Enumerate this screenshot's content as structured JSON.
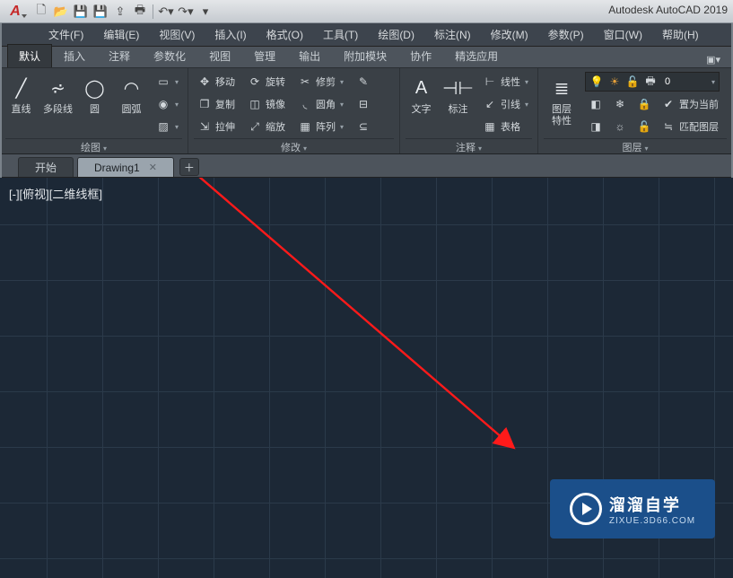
{
  "title": "Autodesk AutoCAD 2019",
  "menubar": {
    "file": "文件(F)",
    "edit": "编辑(E)",
    "view": "视图(V)",
    "insert": "插入(I)",
    "format": "格式(O)",
    "tools": "工具(T)",
    "draw": "绘图(D)",
    "dimension": "标注(N)",
    "modify": "修改(M)",
    "parametric": "参数(P)",
    "window": "窗口(W)",
    "help": "帮助(H)"
  },
  "ribbon_tabs": {
    "default": "默认",
    "insert": "插入",
    "annotate": "注释",
    "parametric": "参数化",
    "view": "视图",
    "manage": "管理",
    "output": "输出",
    "addins": "附加模块",
    "collab": "协作",
    "featured": "精选应用"
  },
  "ribbon": {
    "draw_panel": "绘图",
    "modify_panel": "修改",
    "annotation_panel": "注释",
    "layers_panel": "图层",
    "line": "直线",
    "polyline": "多段线",
    "circle": "圆",
    "arc": "圆弧",
    "move": "移动",
    "copy": "复制",
    "stretch": "拉伸",
    "rotate": "旋转",
    "mirror": "镜像",
    "scale": "缩放",
    "trim": "修剪",
    "fillet": "圆角",
    "array": "阵列",
    "text": "文字",
    "dimension": "标注",
    "linear": "线性",
    "leader": "引线",
    "table": "表格",
    "layer_prop": "图层\n特性",
    "set_current": "置为当前",
    "match_layer": "匹配图层",
    "unsaved_layer_count": "0"
  },
  "doc_tabs": {
    "start": "开始",
    "drawing1": "Drawing1"
  },
  "canvas": {
    "view_label": "[-][俯视][二维线框]"
  },
  "watermark": {
    "line1": "溜溜自学",
    "line2": "ZIXUE.3D66.COM"
  }
}
